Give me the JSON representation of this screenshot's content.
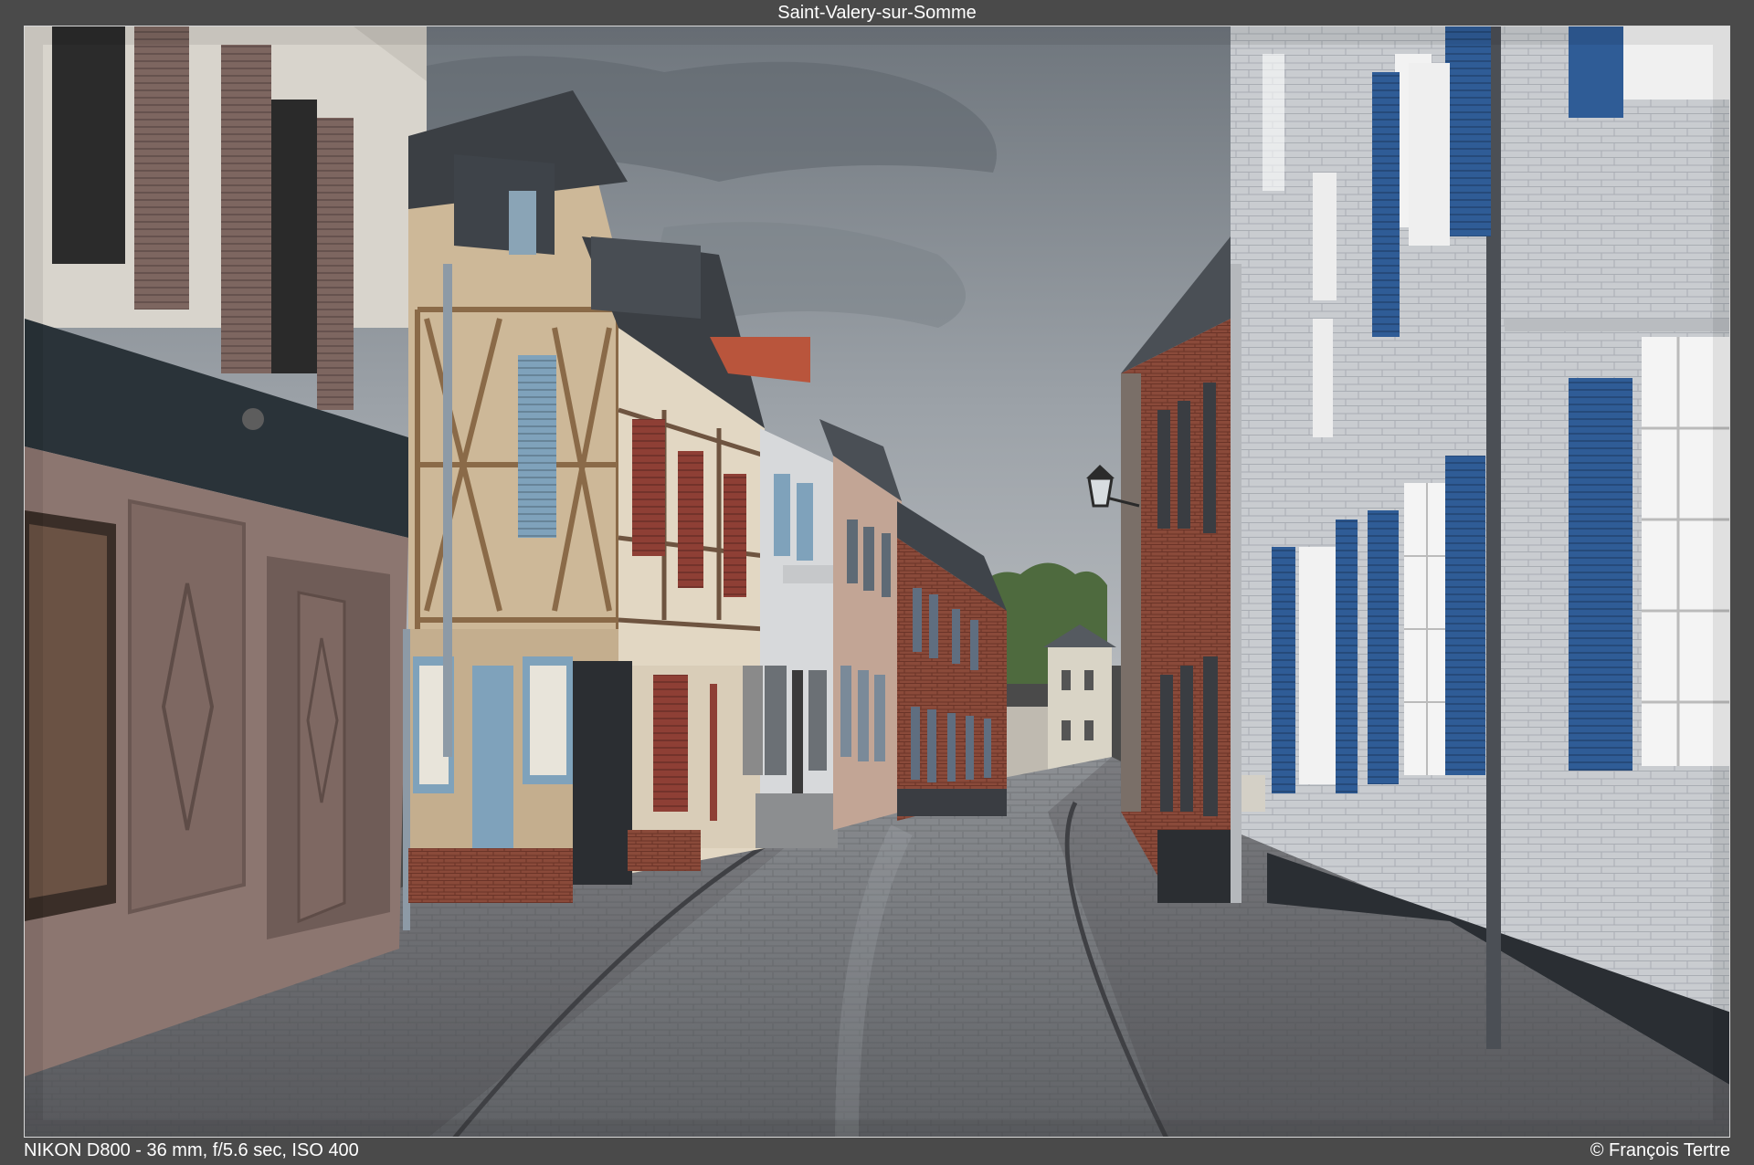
{
  "title": "Saint-Valery-sur-Somme",
  "exif": "NIKON D800 - 36 mm, f/5.6 sec, ISO 400",
  "credit": "© François Tertre",
  "photo": {
    "subject": "street-scene",
    "colors": {
      "sky": "#8a9096",
      "cobblestone": "#6e6e70",
      "left_facade": "#d8d4cc",
      "shop_front": "#8c7670",
      "timber_plaster": "#cdb898",
      "brick": "#8a4a3a",
      "right_facade": "#c9ccd0",
      "blue_shutter": "#2f5c96",
      "pale_blue_shutter": "#7fa2bb",
      "red_shutter": "#8e3f35",
      "dark_band": "#2a2e33"
    }
  }
}
